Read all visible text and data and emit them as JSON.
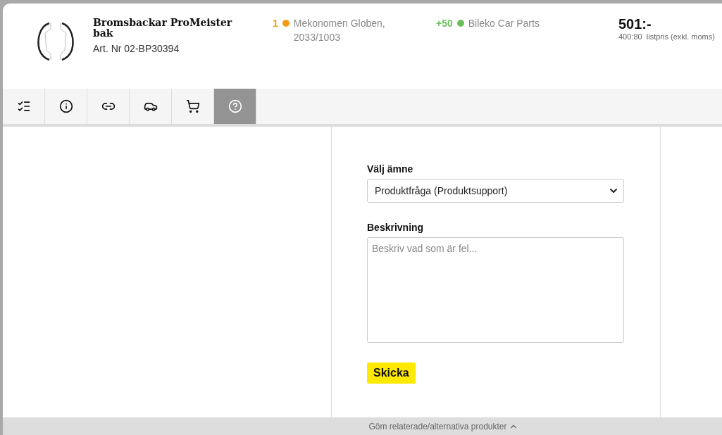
{
  "product": {
    "title": "Bromsbackar ProMeister bak",
    "article": "Art. Nr 02-BP30394"
  },
  "stock": [
    {
      "count": "1",
      "color": "#f39c12",
      "name": "Mekonomen Globen, 2033/1003"
    },
    {
      "count": "+50",
      "color": "#6cbf5c",
      "name": "Bileko Car Parts"
    }
  ],
  "price": {
    "amount": "501:-",
    "list_price": "400:80",
    "list_label": "listpris (exkl. moms)"
  },
  "tabs": [
    {
      "kind": "list",
      "selected": false
    },
    {
      "kind": "info",
      "selected": false
    },
    {
      "kind": "link",
      "selected": false
    },
    {
      "kind": "car",
      "selected": false
    },
    {
      "kind": "cart",
      "selected": false
    },
    {
      "kind": "help",
      "selected": true
    }
  ],
  "form": {
    "subject_label": "Välj ämne",
    "subject_value": "Produktfråga (Produktsupport)",
    "description_label": "Beskrivning",
    "description_placeholder": "Beskriv vad som är fel...",
    "submit": "Skicka"
  },
  "footer": {
    "toggle": "Göm relaterade/alternativa produkter"
  }
}
